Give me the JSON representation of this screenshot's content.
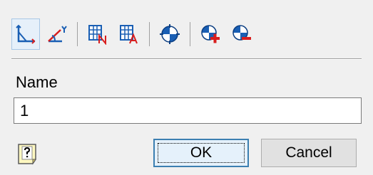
{
  "toolbar": {
    "items": [
      {
        "icon": "axes-icon",
        "active": true
      },
      {
        "icon": "axes-rotate-icon",
        "active": false
      },
      {
        "icon": "grid-name-icon",
        "active": false
      },
      {
        "icon": "grid-angle-icon",
        "active": false
      },
      {
        "icon": "target-icon",
        "active": false
      },
      {
        "icon": "target-add-icon",
        "active": false
      },
      {
        "icon": "target-remove-icon",
        "active": false
      }
    ]
  },
  "form": {
    "name_label": "Name",
    "name_value": "1"
  },
  "buttons": {
    "ok_label": "OK",
    "cancel_label": "Cancel",
    "help_icon": "help-icon"
  },
  "colors": {
    "background": "#f0f0f0",
    "accent_blue": "#1a5fb4",
    "accent_red": "#d81e1e",
    "focus_border": "#3c7fb1"
  }
}
